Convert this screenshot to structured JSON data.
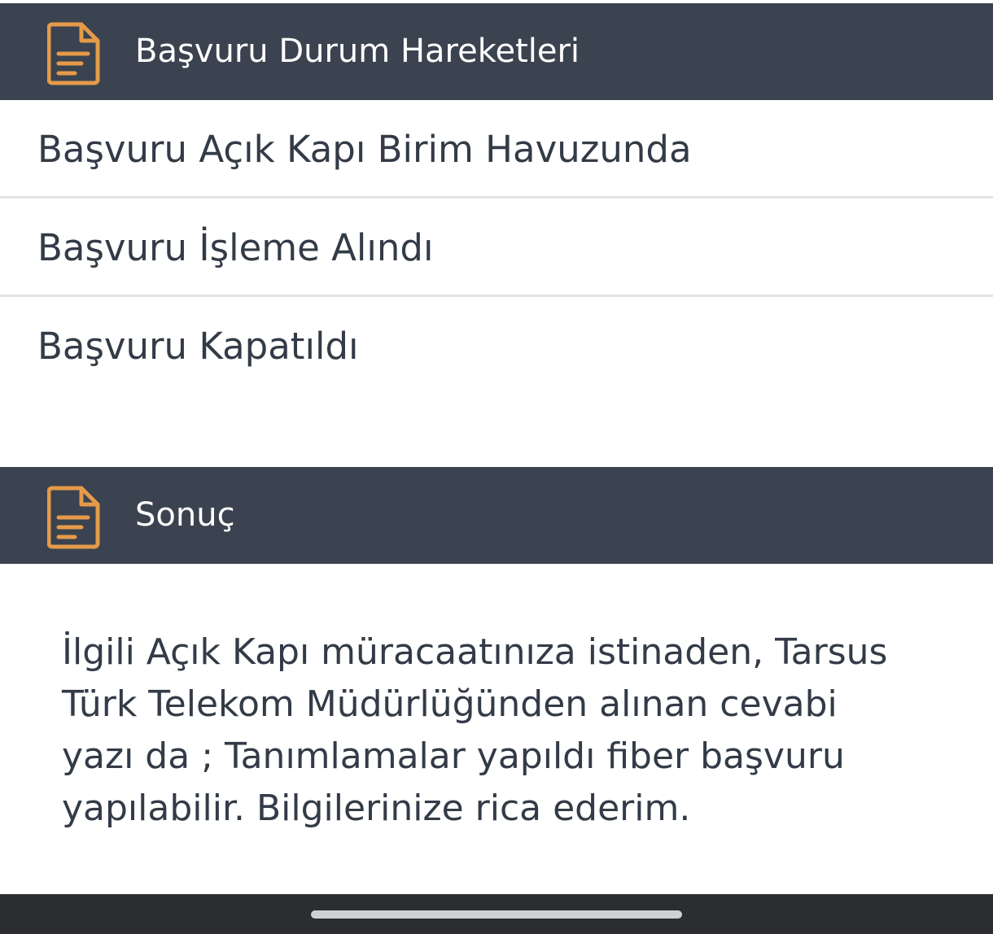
{
  "colors": {
    "header_bg": "#3a434f",
    "icon_accent": "#e59a4a",
    "text_primary": "#333b47",
    "divider": "#e2e4e7",
    "bottom_bar": "#2b2d31"
  },
  "status_section": {
    "icon": "document-icon",
    "title": "Başvuru Durum Hareketleri",
    "items": [
      {
        "label": "Başvuru Açık Kapı Birim Havuzunda"
      },
      {
        "label": "Başvuru İşleme Alındı"
      },
      {
        "label": "Başvuru Kapatıldı"
      }
    ]
  },
  "result_section": {
    "icon": "document-icon",
    "title": "Sonuç",
    "lines": [
      "İlgili Açık Kapı müracaatınıza istinaden, Tarsus",
      "Türk Telekom Müdürlüğünden alınan cevabi",
      "yazı da ; Tanımlamalar yapıldı fiber başvuru",
      "yapılabilir. Bilgilerinize rica ederim."
    ]
  }
}
